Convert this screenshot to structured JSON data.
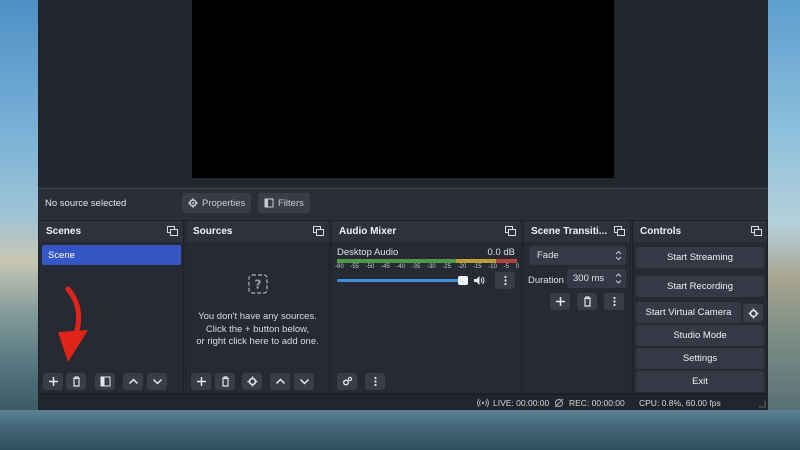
{
  "source_toolbar": {
    "no_source_label": "No source selected",
    "properties_label": "Properties",
    "filters_label": "Filters"
  },
  "scenes": {
    "title": "Scenes",
    "items": [
      "Scene"
    ]
  },
  "sources": {
    "title": "Sources",
    "empty_line1": "You don't have any sources.",
    "empty_line2": "Click the + button below,",
    "empty_line3": "or right click here to add one."
  },
  "audio_mixer": {
    "title": "Audio Mixer",
    "channel_name": "Desktop Audio",
    "channel_level": "0.0 dB",
    "scale": [
      "-60",
      "-55",
      "-50",
      "-45",
      "-40",
      "-35",
      "-30",
      "-25",
      "-20",
      "-15",
      "-10",
      "-5",
      "0"
    ],
    "volume_fraction": 1.0
  },
  "scene_transitions": {
    "title": "Scene Transiti...",
    "transition": "Fade",
    "duration_label": "Duration",
    "duration_value": "300 ms"
  },
  "controls": {
    "title": "Controls",
    "start_streaming": "Start Streaming",
    "start_recording": "Start Recording",
    "start_virtual_camera": "Start Virtual Camera",
    "studio_mode": "Studio Mode",
    "settings": "Settings",
    "exit": "Exit"
  },
  "status_bar": {
    "live": "LIVE: 00:00:00",
    "rec": "REC: 00:00:00",
    "cpu": "CPU: 0.8%, 60.00 fps"
  },
  "colors": {
    "accent": "#3556c5",
    "annotation_arrow": "#e0241a",
    "meter_green": "#4c9a47",
    "meter_yellow": "#b8a132",
    "meter_red": "#b5423c",
    "slider_blue": "#3a8fde"
  }
}
